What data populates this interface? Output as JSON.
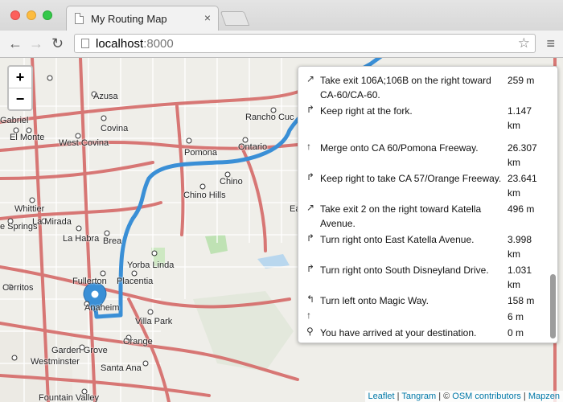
{
  "browser": {
    "tab_title": "My Routing Map",
    "tab_close": "×",
    "url_host": "localhost",
    "url_port": ":8000"
  },
  "map": {
    "zoom_in": "+",
    "zoom_out": "−",
    "places": [
      "Azusa",
      "Gabriel",
      "Covina",
      "El Monte",
      "West Covina",
      "Rancho Cuc",
      "Pomona",
      "Ontario",
      "Chino",
      "Chino Hills",
      "Ea",
      "Whittier",
      "La Mirada",
      "e Springs",
      "La Habra",
      "Brea",
      "Yorba Linda",
      "Fullerton",
      "Placentia",
      "Cerritos",
      "Anaheim",
      "Villa Park",
      "Orange",
      "Garden Grove",
      "Westminster",
      "Santa Ana",
      "Fountain Valley"
    ],
    "route_color": "#3a8fd6",
    "marker_color": "#3a8fd6"
  },
  "attribution": {
    "leaflet": "Leaflet",
    "sep1": " | ",
    "tangram": "Tangram",
    "sep2": " | © ",
    "osm": "OSM contributors",
    "sep3": " | ",
    "mapzen": "Mapzen"
  },
  "directions": [
    {
      "icon": "exit-right-icon",
      "glyph": "↗",
      "text": "Take exit 106A;106B on the right toward CA-60/CA-60.",
      "distance": "259 m"
    },
    {
      "icon": "keep-right-icon",
      "glyph": "↱",
      "text": "Keep right at the fork.",
      "distance": "1.147 km"
    },
    {
      "icon": "straight-icon",
      "glyph": "↑",
      "text": "Merge onto CA 60/Pomona Freeway.",
      "distance": "26.307 km"
    },
    {
      "icon": "keep-right-icon",
      "glyph": "↱",
      "text": "Keep right to take CA 57/Orange Freeway.",
      "distance": "23.641 km"
    },
    {
      "icon": "exit-right-icon",
      "glyph": "↗",
      "text": "Take exit 2 on the right toward Katella Avenue.",
      "distance": "496 m"
    },
    {
      "icon": "turn-right-icon",
      "glyph": "↱",
      "text": "Turn right onto East Katella Avenue.",
      "distance": "3.998 km"
    },
    {
      "icon": "turn-right-icon",
      "glyph": "↱",
      "text": "Turn right onto South Disneyland Drive.",
      "distance": "1.031 km"
    },
    {
      "icon": "turn-left-icon",
      "glyph": "↰",
      "text": "Turn left onto Magic Way.",
      "distance": "158 m"
    },
    {
      "icon": "straight-icon",
      "glyph": "↑",
      "text": "",
      "distance": "6 m"
    },
    {
      "icon": "destination-icon",
      "glyph": "⚲",
      "text": "You have arrived at your destination.",
      "distance": "0 m"
    }
  ]
}
